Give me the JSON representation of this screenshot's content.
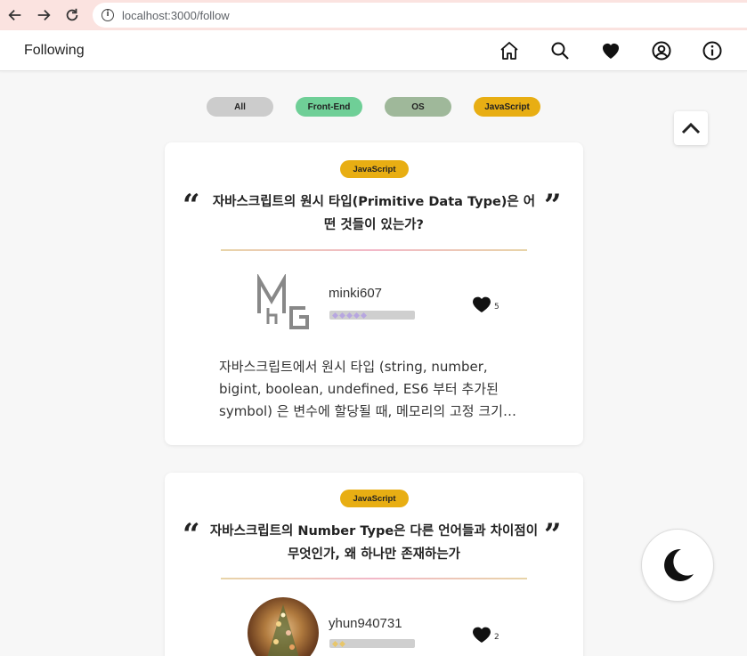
{
  "browser": {
    "url": "localhost:3000/follow"
  },
  "header": {
    "title": "Following",
    "icons": [
      "home-icon",
      "search-icon",
      "heart-icon",
      "user-circle-icon",
      "info-icon"
    ]
  },
  "filters": [
    {
      "label": "All",
      "color": "#cccccc"
    },
    {
      "label": "Front-End",
      "color": "#6fcf97"
    },
    {
      "label": "OS",
      "color": "#9fb89a"
    },
    {
      "label": "JavaScript",
      "color": "#e8ae13"
    }
  ],
  "posts": [
    {
      "tag": "JavaScript",
      "title": "자바스크립트의 원시 타입(Primitive Data Type)은 어떤 것들이 있는가?",
      "author": "minki607",
      "level_dots": 5,
      "likes": "5",
      "excerpt": "자바스크립트에서 원시 타입 (string, number, bigint, boolean, undefined, ES6 부터 추가된 symbol) 은 변수에 할당될 때, 메모리의 고정 크기…"
    },
    {
      "tag": "JavaScript",
      "title": "자바스크립트의 Number Type은 다른 언어들과 차이점이 무엇인가, 왜 하나만 존재하는가",
      "author": "yhun940731",
      "level_dots": 2,
      "likes": "2"
    }
  ],
  "colors": {
    "accent": "#e8ae13",
    "browser_bar": "#fbe3e0"
  }
}
